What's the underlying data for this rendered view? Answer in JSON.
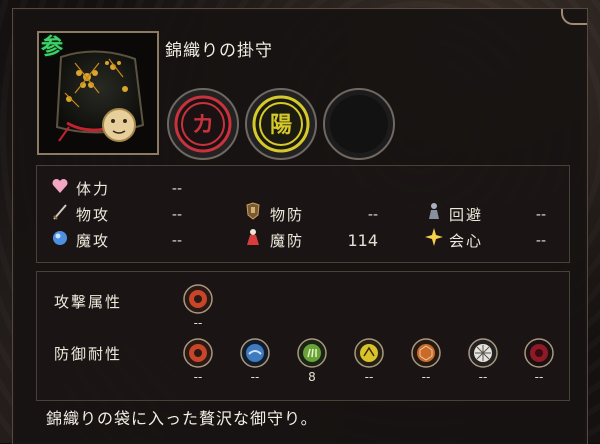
{
  "item": {
    "name": "錦織りの掛守",
    "badge_glyph": "参",
    "description": "錦織りの袋に入った贅沢な御守り。"
  },
  "slots": [
    {
      "glyph": "カ",
      "color": "#c8323c",
      "state": "filled"
    },
    {
      "glyph": "陽",
      "color": "#d6c92a",
      "state": "filled"
    },
    {
      "glyph": "",
      "color": "#2a2828",
      "state": "empty"
    }
  ],
  "stats": {
    "tairyoku": {
      "label": "体力",
      "value": "--",
      "icon": "heart-icon"
    },
    "butsukou": {
      "label": "物攻",
      "value": "--",
      "icon": "sword-icon"
    },
    "makou": {
      "label": "魔攻",
      "value": "--",
      "icon": "magic-orb-icon"
    },
    "butsubou": {
      "label": "物防",
      "value": "--",
      "icon": "armor-icon"
    },
    "mabou": {
      "label": "魔防",
      "value": "114",
      "icon": "magic-robe-icon"
    },
    "kaihi": {
      "label": "回避",
      "value": "--",
      "icon": "evasion-icon"
    },
    "kaishin": {
      "label": "会心",
      "value": "--",
      "icon": "critical-spark-icon"
    }
  },
  "attack_attribute": {
    "label": "攻撃属性",
    "items": [
      {
        "icon": "fire-element-icon",
        "value": "--"
      }
    ]
  },
  "defense_resist": {
    "label": "防御耐性",
    "items": [
      {
        "icon": "fire-resist-icon",
        "value": "--",
        "color": "#c9452a"
      },
      {
        "icon": "water-resist-icon",
        "value": "--",
        "color": "#3e7bbf"
      },
      {
        "icon": "wind-resist-icon",
        "value": "8",
        "color": "#6aa23a"
      },
      {
        "icon": "thunder-resist-icon",
        "value": "--",
        "color": "#d9c22a"
      },
      {
        "icon": "earth-resist-icon",
        "value": "--",
        "color": "#c76a2a"
      },
      {
        "icon": "light-resist-icon",
        "value": "--",
        "color": "#e8e4dc"
      },
      {
        "icon": "dark-resist-icon",
        "value": "--",
        "color": "#8f1a26"
      }
    ]
  }
}
